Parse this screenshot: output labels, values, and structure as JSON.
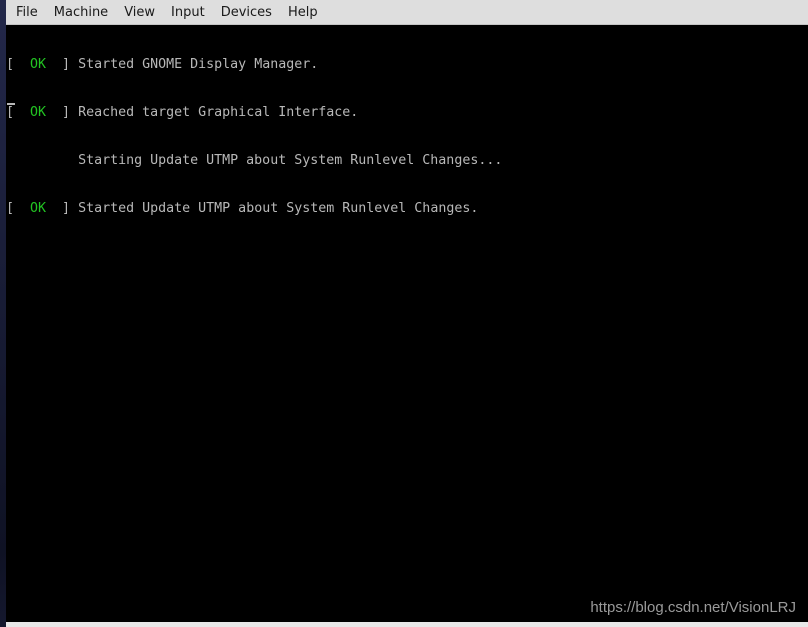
{
  "menu": [
    "File",
    "Machine",
    "View",
    "Input",
    "Devices",
    "Help"
  ],
  "console": [
    {
      "status": "OK",
      "text": "Started GNOME Display Manager."
    },
    {
      "status": "OK",
      "text": "Reached target Graphical Interface."
    },
    {
      "status": null,
      "text": "Starting Update UTMP about System Runlevel Changes..."
    },
    {
      "status": "OK",
      "text": "Started Update UTMP about System Runlevel Changes."
    }
  ],
  "watermark": "https://blog.csdn.net/VisionLRJ",
  "colors": {
    "ok": "#22c422",
    "text": "#b8b8b8",
    "background": "#000000",
    "menubar": "#dedede"
  }
}
